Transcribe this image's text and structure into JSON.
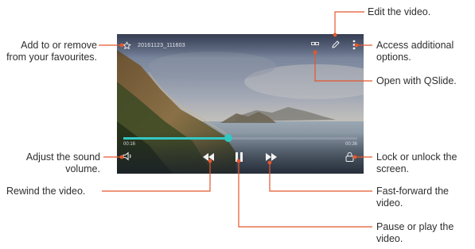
{
  "player": {
    "file_title": "20161123_111603",
    "time_elapsed": "00:16",
    "time_total": "00:36",
    "progress": 0.45,
    "accent_color": "#33c7c2",
    "icons": {
      "favourite": "star-icon",
      "qslide": "qslide-icon",
      "edit": "pencil-icon",
      "options": "more-options-icon",
      "volume": "speaker-icon",
      "rewind": "rewind-icon",
      "pause": "pause-icon",
      "fast_forward": "fast-forward-icon",
      "lock": "lock-icon"
    }
  },
  "callouts": {
    "favourite": "Add to or remove from your favourites.",
    "volume": "Adjust the sound volume.",
    "rewind": "Rewind the video.",
    "edit": "Edit the video.",
    "options": "Access additional options.",
    "qslide": "Open with QSlide.",
    "lock": "Lock or unlock the screen.",
    "fast_forward": "Fast-forward the video.",
    "pause": "Pause or play the video."
  }
}
